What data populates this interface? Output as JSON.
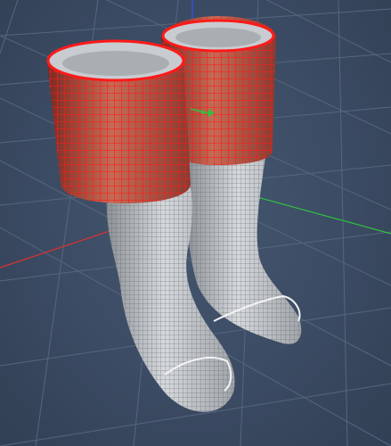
{
  "viewport": {
    "background_color": "#3a4a60",
    "grid_color": "#55667d",
    "axis_colors": {
      "x": "#e03030",
      "y": "#30c040",
      "z": "#3050ff"
    }
  },
  "model": {
    "object": "boots",
    "mesh_color": "#c8ccd0",
    "selected_faces_color": "#ff1a1a",
    "selection": "cuffs",
    "display": "wireframe-on-shaded"
  },
  "manipulator": {
    "icon": "move-gizmo-icon",
    "color": "#30c040"
  }
}
